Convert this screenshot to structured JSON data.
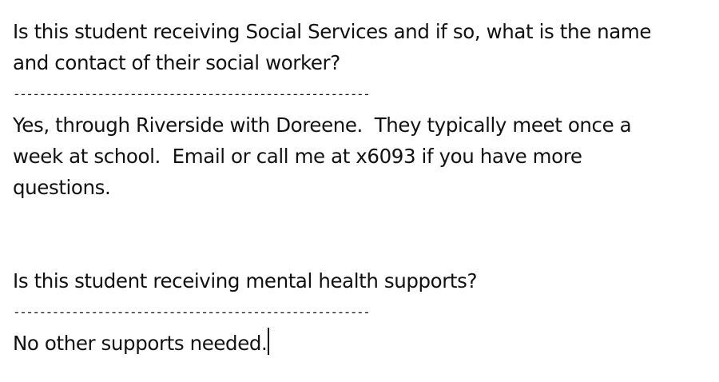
{
  "document": {
    "blocks": [
      {
        "question_lines": [
          "Is this student receiving Social Services and if so, what is the name",
          "and contact of their social worker?"
        ],
        "separator": "-------------------------------------------------------",
        "answer_lines": [
          "Yes, through Riverside with Doreene.  They typically meet once a",
          "week at school.  Email or call me at x6093 if you have more",
          "questions."
        ]
      },
      {
        "question_lines": [
          "Is this student receiving mental health supports?"
        ],
        "separator": "-------------------------------------------------------",
        "answer_lines": [
          "No other supports needed."
        ]
      }
    ]
  }
}
